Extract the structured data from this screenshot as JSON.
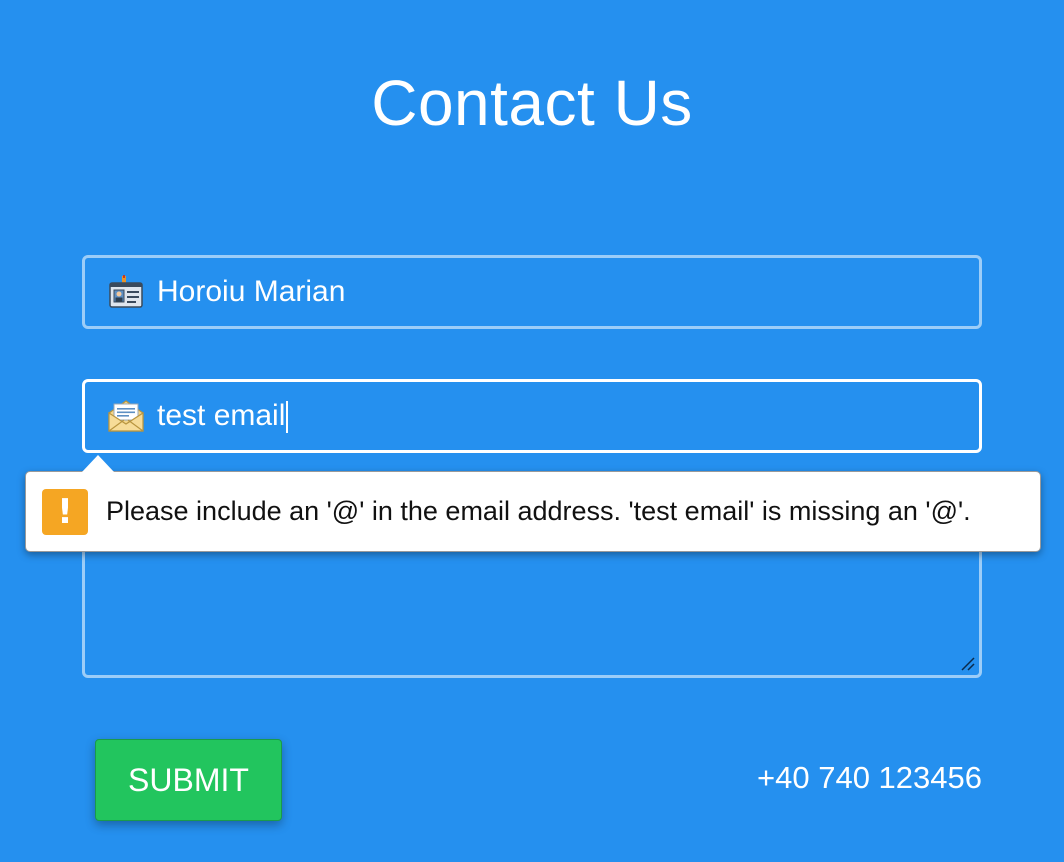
{
  "title": "Contact Us",
  "form": {
    "name_value": "Horoiu Marian",
    "email_value": "test email",
    "message_value": "",
    "submit_label": "SUBMIT"
  },
  "validation": {
    "message": "Please include an '@' in the email address. 'test email' is missing an '@'.",
    "icon": "!"
  },
  "contact": {
    "phone": "+40 740 123456"
  },
  "colors": {
    "background": "#2590ef",
    "submit": "#22c55e",
    "warning": "#f5a623"
  },
  "icons": {
    "name": "id-card-icon",
    "email": "envelope-icon",
    "warning": "warning-icon"
  }
}
